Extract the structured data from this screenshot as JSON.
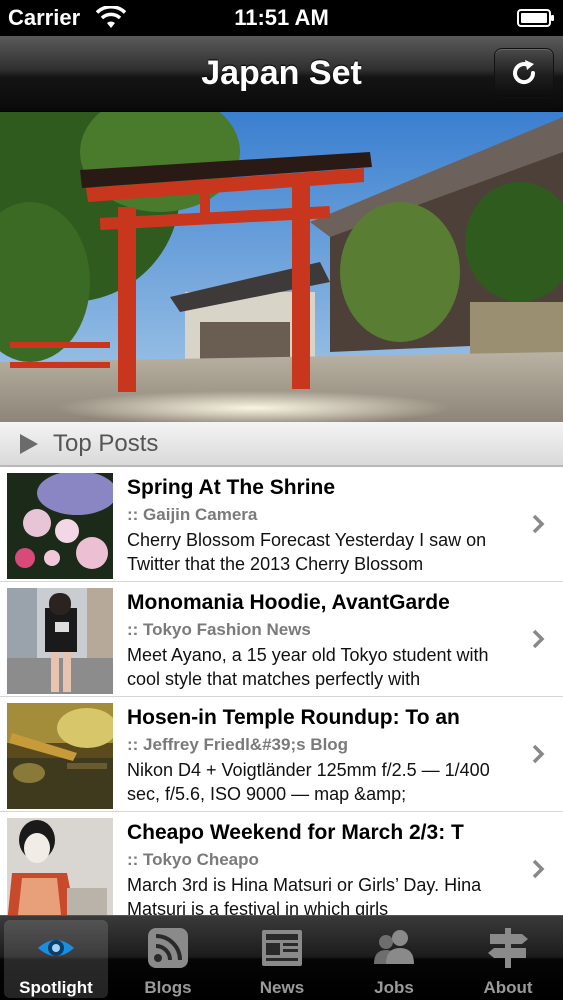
{
  "status_bar": {
    "carrier": "Carrier",
    "time": "11:51 AM"
  },
  "nav": {
    "title": "Japan Set"
  },
  "section": {
    "title": "Top Posts"
  },
  "posts": [
    {
      "title": "Spring At The Shrine",
      "source": ":: Gaijin Camera",
      "excerpt": "Cherry Blossom Forecast Yesterday I saw on Twitter that the 2013 Cherry Blossom"
    },
    {
      "title": "Monomania Hoodie, AvantGarde",
      "source": ":: Tokyo Fashion News",
      "excerpt": "Meet Ayano, a 15 year old Tokyo student with cool style that matches perfectly with"
    },
    {
      "title": "Hosen-in Temple Roundup: To an",
      "source": ":: Jeffrey Friedl&#39;s Blog",
      "excerpt": " Nikon D4 + Voigtländer 125mm f/2.5 — 1/400 sec, f/5.6, ISO 9000 — map &amp;"
    },
    {
      "title": "Cheapo Weekend for March 2/3: T",
      "source": ":: Tokyo Cheapo",
      "excerpt": " March 3rd is Hina Matsuri or Girls’ Day. Hina Matsuri is a festival in which girls"
    }
  ],
  "tabs": [
    {
      "label": "Spotlight",
      "icon": "eye-icon",
      "selected": true
    },
    {
      "label": "Blogs",
      "icon": "rss-icon",
      "selected": false
    },
    {
      "label": "News",
      "icon": "newspaper-icon",
      "selected": false
    },
    {
      "label": "Jobs",
      "icon": "people-icon",
      "selected": false
    },
    {
      "label": "About",
      "icon": "signpost-icon",
      "selected": false
    }
  ],
  "colors": {
    "nav_dark": "#141414",
    "tab_active_icon": "#1a8fe0",
    "tab_inactive_icon": "#8a8a8a"
  }
}
